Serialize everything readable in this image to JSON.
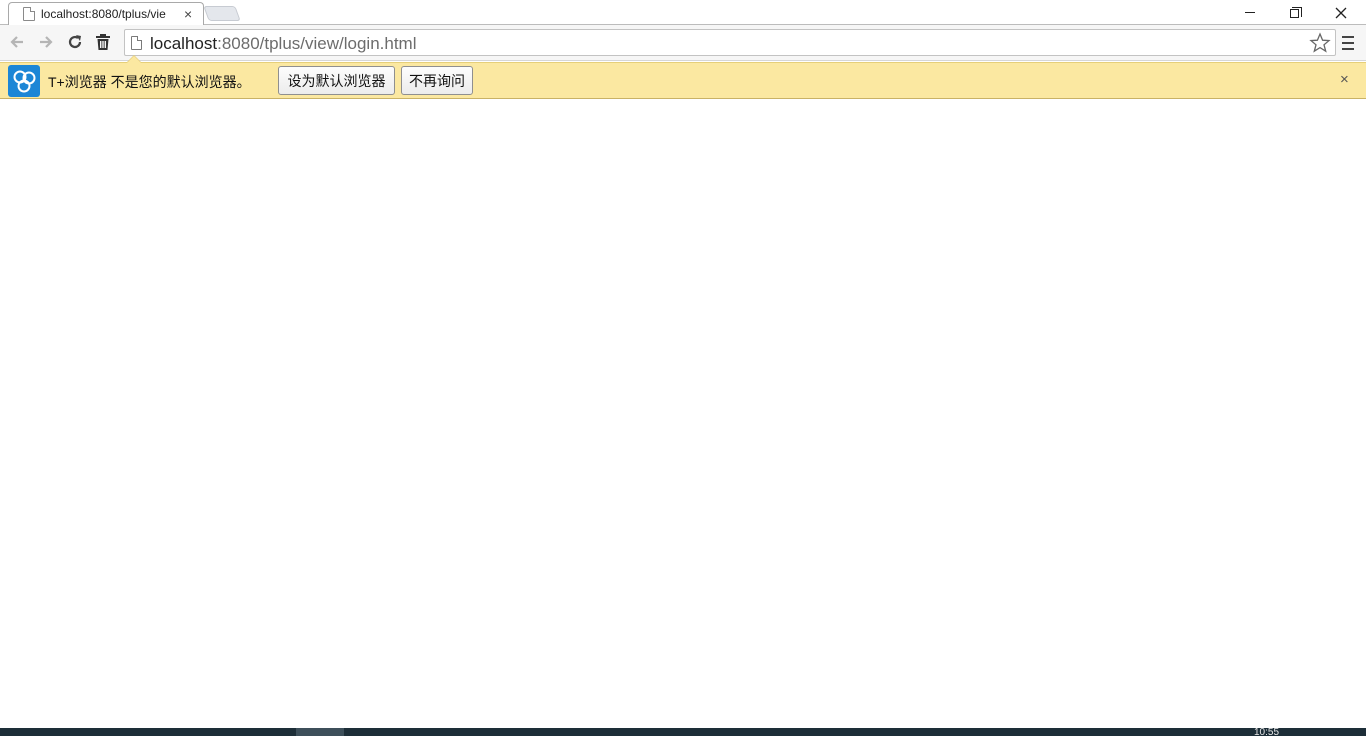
{
  "browser": {
    "tab": {
      "title": "localhost:8080/tplus/vie",
      "close_label": "×"
    },
    "address": {
      "host": "localhost",
      "rest": ":8080/tplus/view/login.html"
    }
  },
  "infobar": {
    "message": "T+浏览器 不是您的默认浏览器。",
    "set_default_label": "设为默认浏览器",
    "never_ask_label": "不再询问",
    "close_label": "×"
  },
  "taskbar": {
    "clock": "10:55"
  },
  "colors": {
    "infobar_bg": "#fbe8a1",
    "logo_blue": "#1c86d6",
    "taskbar": "#1d2e38"
  }
}
